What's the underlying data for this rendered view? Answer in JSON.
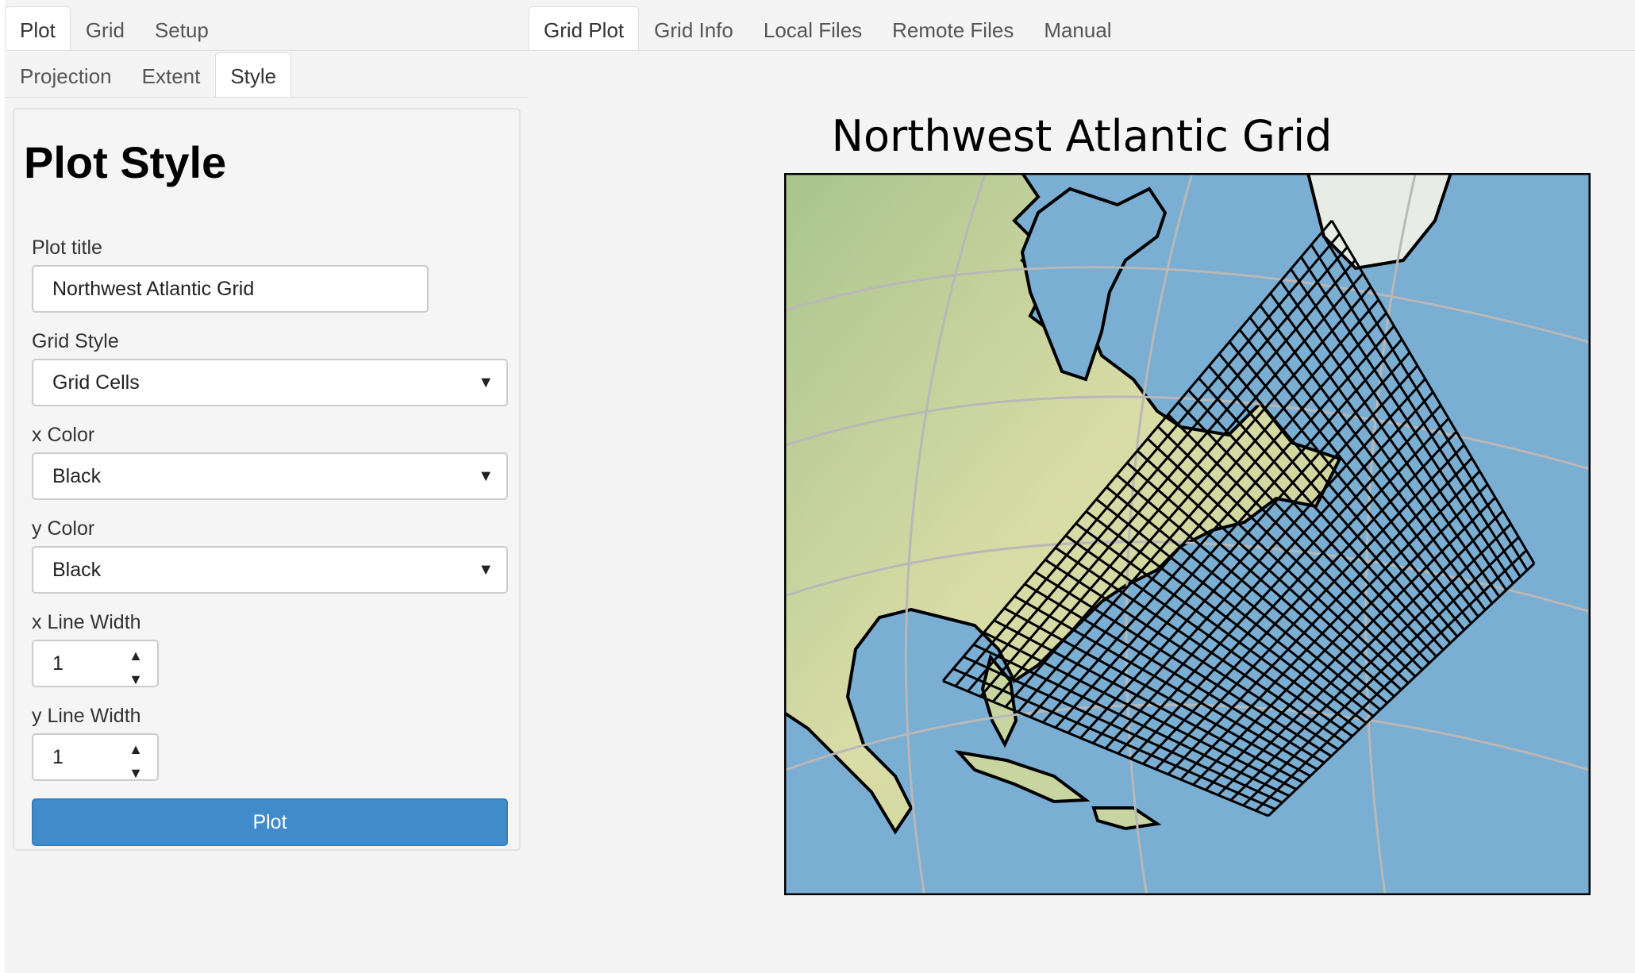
{
  "left_tabs": [
    {
      "label": "Plot",
      "active": true
    },
    {
      "label": "Grid",
      "active": false
    },
    {
      "label": "Setup",
      "active": false
    }
  ],
  "sub_tabs": [
    {
      "label": "Projection",
      "active": false
    },
    {
      "label": "Extent",
      "active": false
    },
    {
      "label": "Style",
      "active": true
    }
  ],
  "right_tabs": [
    {
      "label": "Grid Plot",
      "active": true
    },
    {
      "label": "Grid Info",
      "active": false
    },
    {
      "label": "Local Files",
      "active": false
    },
    {
      "label": "Remote Files",
      "active": false
    },
    {
      "label": "Manual",
      "active": false
    }
  ],
  "form": {
    "heading": "Plot Style",
    "plot_title_label": "Plot title",
    "plot_title_value": "Northwest Atlantic Grid",
    "grid_style_label": "Grid Style",
    "grid_style_value": "Grid Cells",
    "x_color_label": "x Color",
    "x_color_value": "Black",
    "y_color_label": "y Color",
    "y_color_value": "Black",
    "x_line_width_label": "x Line Width",
    "x_line_width_value": "1",
    "y_line_width_label": "y Line Width",
    "y_line_width_value": "1",
    "plot_button": "Plot"
  },
  "plot": {
    "title": "Northwest Atlantic Grid"
  },
  "colors": {
    "accent": "#428bca",
    "ocean": "#7aaed2",
    "land": "#c9d5a0",
    "grid_line": "#000000"
  }
}
